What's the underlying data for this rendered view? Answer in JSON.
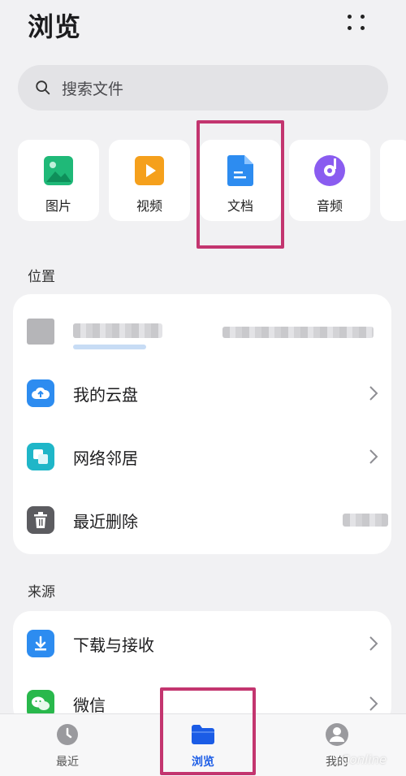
{
  "header": {
    "title": "浏览"
  },
  "search": {
    "placeholder": "搜索文件"
  },
  "categories": [
    {
      "label": "图片",
      "icon": "image-icon",
      "color": "#1fb978"
    },
    {
      "label": "视频",
      "icon": "video-icon",
      "color": "#f5a01c"
    },
    {
      "label": "文档",
      "icon": "document-icon",
      "color": "#2d8cf0"
    },
    {
      "label": "音频",
      "icon": "audio-icon",
      "color": "#8a5cf0"
    }
  ],
  "locations": {
    "title": "位置",
    "items": [
      {
        "label": "我的云盘",
        "icon": "cloud-icon",
        "color": "#2d8cf0"
      },
      {
        "label": "网络邻居",
        "icon": "network-icon",
        "color": "#1fb6c8"
      },
      {
        "label": "最近删除",
        "icon": "trash-icon",
        "color": "#5c5c60"
      }
    ]
  },
  "sources": {
    "title": "来源",
    "items": [
      {
        "label": "下载与接收",
        "icon": "download-icon",
        "color": "#2d8cf0"
      },
      {
        "label": "微信",
        "icon": "wechat-icon",
        "color": "#29b84c"
      }
    ]
  },
  "tabbar": {
    "items": [
      {
        "label": "最近",
        "icon": "clock-icon"
      },
      {
        "label": "浏览",
        "icon": "folder-icon",
        "active": true
      },
      {
        "label": "我的",
        "icon": "profile-icon"
      }
    ]
  },
  "watermark": "Conline",
  "colors": {
    "accent": "#1b5ce6",
    "highlight": "#c3356f",
    "background": "#f1f1f3"
  }
}
